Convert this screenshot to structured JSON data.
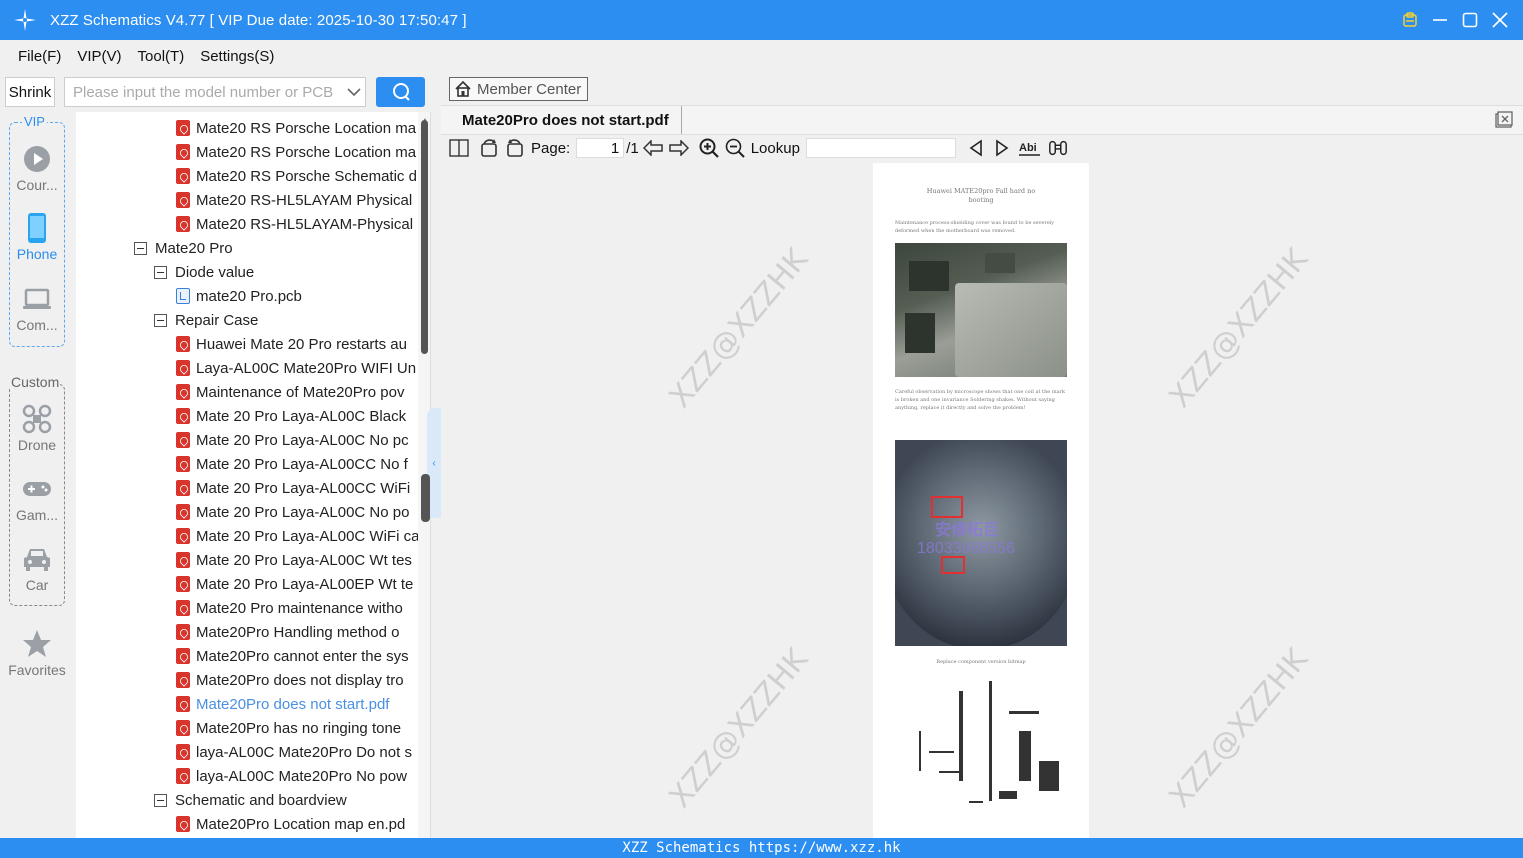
{
  "window": {
    "title": "XZZ Schematics V4.77 [ VIP Due date: 2025-10-30 17:50:47 ]",
    "controls": [
      "clipboard-icon",
      "minimize-icon",
      "maximize-icon",
      "close-icon"
    ]
  },
  "menu": {
    "items": [
      "File(F)",
      "VIP(V)",
      "Tool(T)",
      "Settings(S)"
    ]
  },
  "search": {
    "shrink_label": "Shrink",
    "placeholder": "Please input the model number or PCB"
  },
  "leftnav": {
    "vip_label": "VIP",
    "custom_label": "Custom",
    "items": [
      {
        "label": "Cour...",
        "icon": "play-circle-icon"
      },
      {
        "label": "Phone",
        "icon": "phone-icon",
        "active": true
      },
      {
        "label": "Com...",
        "icon": "laptop-icon"
      },
      {
        "label": "Drone",
        "icon": "drone-icon"
      },
      {
        "label": "Gam...",
        "icon": "gamepad-icon"
      },
      {
        "label": "Car",
        "icon": "car-icon"
      },
      {
        "label": "Favorites",
        "icon": "star-icon"
      }
    ]
  },
  "tree": {
    "rows": [
      {
        "text": "Mate20 RS Porsche Location ma",
        "type": "pdf",
        "level": 3
      },
      {
        "text": "Mate20 RS Porsche Location ma",
        "type": "pdf",
        "level": 3
      },
      {
        "text": "Mate20 RS Porsche Schematic d",
        "type": "pdf",
        "level": 3
      },
      {
        "text": "Mate20 RS-HL5LAYAM Physical",
        "type": "pdf",
        "level": 3
      },
      {
        "text": "Mate20 RS-HL5LAYAM-Physical",
        "type": "pdf",
        "level": 3
      },
      {
        "text": "Mate20 Pro",
        "type": "folder",
        "level": 1
      },
      {
        "text": "Diode value",
        "type": "folder",
        "level": 2
      },
      {
        "text": "mate20 Pro.pcb",
        "type": "pcb",
        "level": 3
      },
      {
        "text": "Repair Case",
        "type": "folder",
        "level": 2
      },
      {
        "text": "Huawei Mate 20 Pro restarts au",
        "type": "pdf",
        "level": 3
      },
      {
        "text": "Laya-AL00C Mate20Pro WIFI Un",
        "type": "pdf",
        "level": 3
      },
      {
        "text": "Maintenance of Mate20Pro pov",
        "type": "pdf",
        "level": 3
      },
      {
        "text": "Mate 20 Pro  Laya-AL00C Black",
        "type": "pdf",
        "level": 3
      },
      {
        "text": "Mate 20 Pro  Laya-AL00C No pc",
        "type": "pdf",
        "level": 3
      },
      {
        "text": "Mate 20 Pro  Laya-AL00CC No f",
        "type": "pdf",
        "level": 3
      },
      {
        "text": "Mate 20 Pro  Laya-AL00CC WiFi",
        "type": "pdf",
        "level": 3
      },
      {
        "text": "Mate 20 Pro Laya-AL00C No po",
        "type": "pdf",
        "level": 3
      },
      {
        "text": "Mate 20 Pro Laya-AL00C WiFi ca",
        "type": "pdf",
        "level": 3
      },
      {
        "text": "Mate 20 Pro Laya-AL00C Wt tes",
        "type": "pdf",
        "level": 3
      },
      {
        "text": "Mate 20 Pro Laya-AL00EP Wt te",
        "type": "pdf",
        "level": 3
      },
      {
        "text": "Mate20 Pro maintenance witho",
        "type": "pdf",
        "level": 3
      },
      {
        "text": "Mate20Pro Handling method o",
        "type": "pdf",
        "level": 3
      },
      {
        "text": "Mate20Pro cannot enter the sys",
        "type": "pdf",
        "level": 3
      },
      {
        "text": "Mate20Pro does not display tro",
        "type": "pdf",
        "level": 3
      },
      {
        "text": "Mate20Pro does not start.pdf",
        "type": "pdf",
        "level": 3,
        "selected": true
      },
      {
        "text": "Mate20Pro has no ringing tone",
        "type": "pdf",
        "level": 3
      },
      {
        "text": "laya-AL00C Mate20Pro Do not s",
        "type": "pdf",
        "level": 3
      },
      {
        "text": "laya-AL00C Mate20Pro No pow",
        "type": "pdf",
        "level": 3
      },
      {
        "text": "Schematic and boardview",
        "type": "folder",
        "level": 2
      },
      {
        "text": "Mate20Pro Location map en.pd",
        "type": "pdf",
        "level": 3
      }
    ]
  },
  "viewer": {
    "member_center": "Member Center",
    "tab_title": "Mate20Pro does not start.pdf",
    "page_label": "Page:",
    "page_current": "1",
    "page_total": "/1",
    "lookup_label": "Lookup",
    "watermark": "XZZ@XZZHK",
    "doc": {
      "title": "Huawei MATE20pro Fall hard no booting",
      "para1": "Maintenance process:shielding cover was found to be severely deformed when the motherboard was removed.",
      "para2": "Careful observation by microscope shows that one coil at the mark is broken and one invariance  Soldering shakes. Without saying anything, replace it directly and solve the problem!",
      "overlay_zh": "安修柘巨",
      "overlay_num": "18033988556",
      "caption3": "Replace component version bitmap"
    }
  },
  "statusbar": {
    "text": "XZZ Schematics https://www.xzz.hk"
  },
  "colors": {
    "accent": "#2b8ef0",
    "pdf_red": "#d9342b",
    "selected_text": "#4a90e2"
  }
}
